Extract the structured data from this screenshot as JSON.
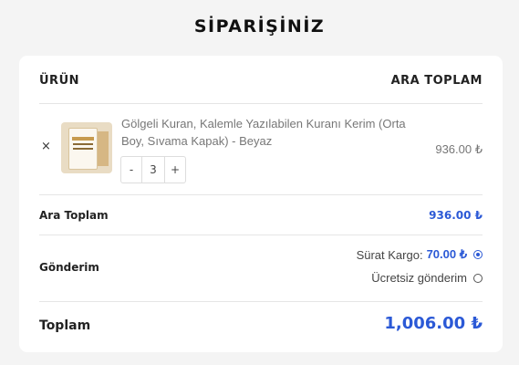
{
  "page": {
    "title": "SİPARİŞİNİZ"
  },
  "table": {
    "col_product": "ÜRÜN",
    "col_subtotal": "ARA TOPLAM"
  },
  "item": {
    "remove_label": "×",
    "name": "Gölgeli Kuran, Kalemle Yazılabilen Kuranı Kerim (Orta Boy, Sıvama Kapak) - Beyaz",
    "quantity": "3",
    "minus_label": "-",
    "plus_label": "+",
    "price": "936.00 ₺"
  },
  "subtotal": {
    "label": "Ara Toplam",
    "value": "936.00 ₺"
  },
  "shipping": {
    "label": "Gönderim",
    "options": [
      {
        "label": "Sürat Kargo:",
        "price": "70.00 ₺",
        "selected": true
      },
      {
        "label": "Ücretsiz gönderim",
        "price": "",
        "selected": false
      }
    ]
  },
  "total": {
    "label": "Toplam",
    "value": "1,006.00 ₺"
  },
  "colors": {
    "accent": "#2b59d6",
    "background": "#f4f4f4"
  }
}
